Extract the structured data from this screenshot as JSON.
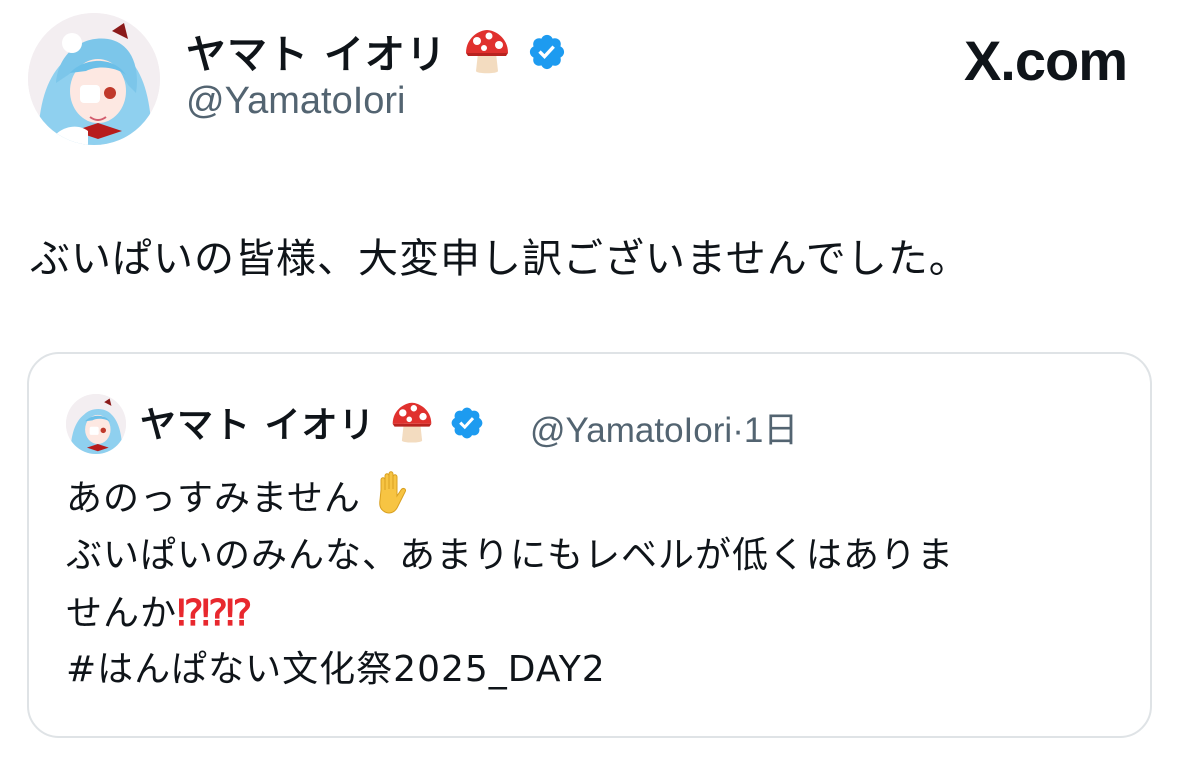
{
  "brand": {
    "text": "X.com"
  },
  "author": {
    "display_name": "ヤマト イオリ",
    "handle": "@YamatoIori",
    "badge_icon": "mushroom-emoji",
    "verified_icon": "verified-badge-icon"
  },
  "tweet": {
    "text": "ぶいぱいの皆様、大変申し訳ございませんでした。"
  },
  "quoted": {
    "display_name": "ヤマト イオリ",
    "handle": "@YamatoIori",
    "separator": "·",
    "time": "1日",
    "lines": [
      "あのっすみません",
      "ぶいぱいのみんな、あまりにもレベルが低くはありま",
      "せんか",
      "#はんぱない文化祭2025_DAY2"
    ],
    "line1_emoji": "raised-hand-emoji",
    "line3_emoji": "⁉⁉⁉"
  },
  "colors": {
    "verified": "#1d9bf0",
    "handle": "#536471",
    "border": "#dfe3e6",
    "exclaim": "#e8282e"
  }
}
